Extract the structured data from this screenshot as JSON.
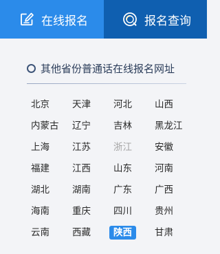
{
  "tabs": {
    "online_signup": "在线报名",
    "signup_query": "报名查询"
  },
  "section": {
    "title": "其他省份普通话在线报名网址"
  },
  "provinces": [
    {
      "name": "北京"
    },
    {
      "name": "天津"
    },
    {
      "name": "河北"
    },
    {
      "name": "山西"
    },
    {
      "name": "内蒙古"
    },
    {
      "name": "辽宁"
    },
    {
      "name": "吉林"
    },
    {
      "name": "黑龙江"
    },
    {
      "name": "上海"
    },
    {
      "name": "江苏"
    },
    {
      "name": "浙江",
      "state": "muted"
    },
    {
      "name": "安徽"
    },
    {
      "name": "福建"
    },
    {
      "name": "江西"
    },
    {
      "name": "山东"
    },
    {
      "name": "河南"
    },
    {
      "name": "湖北"
    },
    {
      "name": "湖南"
    },
    {
      "name": "广东"
    },
    {
      "name": "广西"
    },
    {
      "name": "海南"
    },
    {
      "name": "重庆"
    },
    {
      "name": "四川"
    },
    {
      "name": "贵州"
    },
    {
      "name": "云南"
    },
    {
      "name": "西藏"
    },
    {
      "name": "陕西",
      "state": "active"
    },
    {
      "name": "甘肃"
    }
  ],
  "colors": {
    "tab_active_bg": "#2b8bea",
    "tab_inactive_bg": "#0f5fb0",
    "highlight_bg": "#2b8bea",
    "muted_text": "#a4a4a4"
  }
}
